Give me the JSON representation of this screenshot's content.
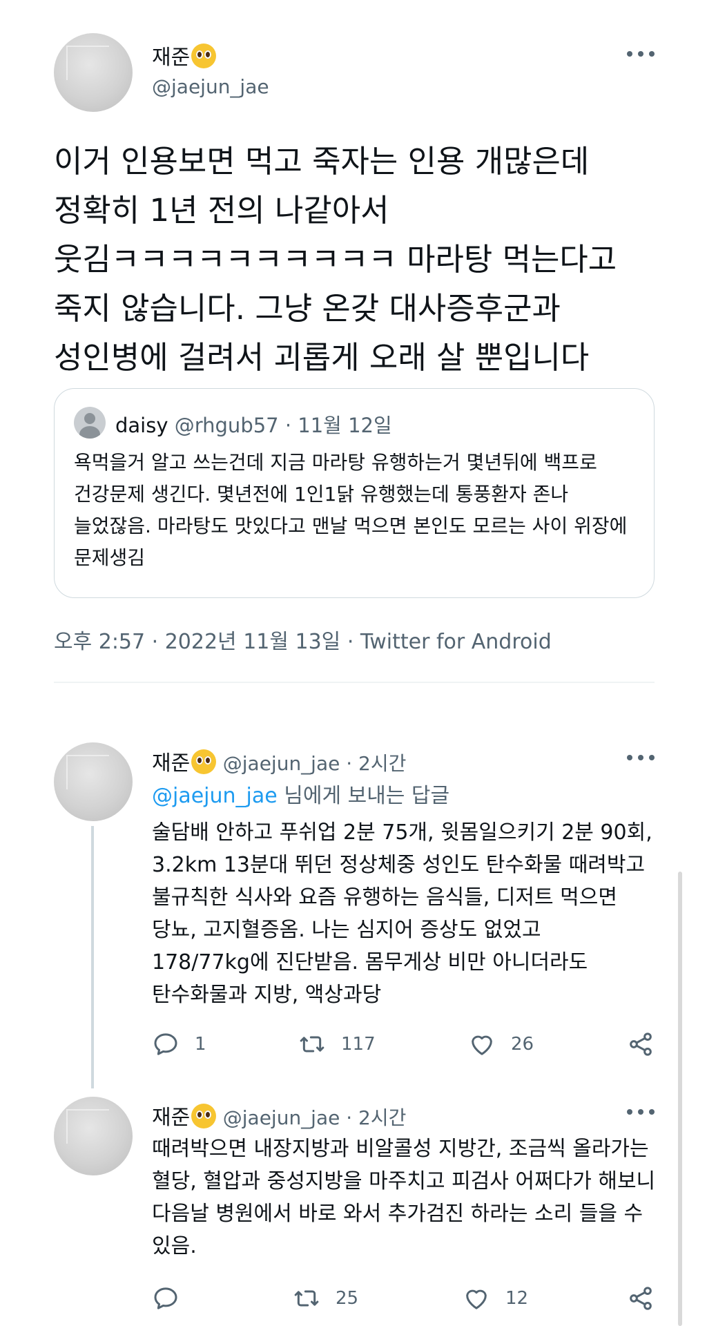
{
  "main_tweet": {
    "display_name": "재준",
    "handle": "@jaejun_jae",
    "text": "이거 인용보면 먹고 죽자는 인용 개많은데 정확히 1년 전의 나같아서 웃김ㅋㅋㅋㅋㅋㅋㅋㅋㅋㅋ 마라탕 먹는다고 죽지 않습니다. 그냥 온갖 대사증후군과 성인병에 걸려서 괴롭게 오래 살 뿐입니다",
    "meta": "오후 2:57 · 2022년 11월 13일 · Twitter for Android"
  },
  "quoted_tweet": {
    "display_name": "daisy",
    "handle": "@rhgub57",
    "separator": "·",
    "date": "11월 12일",
    "text": "욕먹을거 알고 쓰는건데 지금 마라탕 유행하는거 몇년뒤에 백프로 건강문제 생긴다. 몇년전에 1인1닭 유행했는데 통풍환자 존나 늘었잖음. 마라탕도 맛있다고 맨날 먹으면 본인도 모르는 사이 위장에 문제생김"
  },
  "replies": [
    {
      "display_name": "재준",
      "handle_time": "@jaejun_jae · 2시간",
      "replying_to": "@jaejun_jae",
      "replying_suffix": " 님에게 보내는 답글",
      "text": "술담배 안하고 푸쉬업 2분 75개, 윗몸일으키기 2분 90회, 3.2km 13분대 뛰던 정상체중 성인도 탄수화물 때려박고 불규칙한 식사와 요즘 유행하는 음식들, 디저트 먹으면 당뇨, 고지혈증옴. 나는 심지어 증상도 없었고 178/77kg에 진단받음. 몸무게상 비만 아니더라도 탄수화물과 지방, 액상과당",
      "reply_count": "1",
      "retweet_count": "117",
      "like_count": "26"
    },
    {
      "display_name": "재준",
      "handle_time": "@jaejun_jae · 2시간",
      "text": "때려박으면 내장지방과 비알콜성 지방간, 조금씩 올라가는 혈당, 혈압과 중성지방을 마주치고 피검사 어쩌다가 해보니 다음날 병원에서 바로 와서 추가검진 하라는 소리 들을 수 있음.",
      "reply_count": "",
      "retweet_count": "25",
      "like_count": "12"
    }
  ],
  "icons": {
    "more": "more-horizontal-icon",
    "reply": "reply-icon",
    "retweet": "retweet-icon",
    "like": "heart-icon",
    "share": "share-icon",
    "emoji": "pleading-face-emoji"
  },
  "colors": {
    "text": "#0f1419",
    "secondary": "#536471",
    "link": "#1d9bf0",
    "border": "#cfd9de"
  }
}
